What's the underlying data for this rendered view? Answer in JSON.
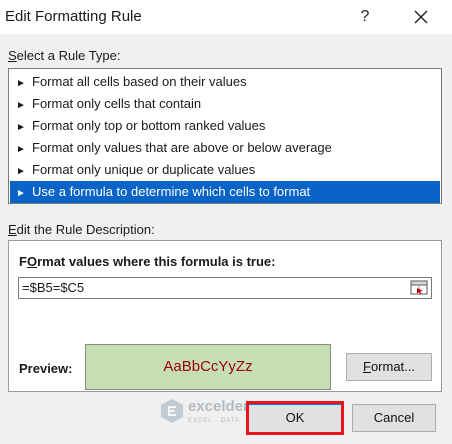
{
  "window": {
    "title": "Edit Formatting Rule",
    "help_glyph": "?",
    "close_glyph": "✕"
  },
  "rule_type": {
    "label": "Select a Rule Type:",
    "label_accel": "S",
    "label_rest": "elect a Rule Type:",
    "items": [
      {
        "label": "Format all cells based on their values",
        "selected": false
      },
      {
        "label": "Format only cells that contain",
        "selected": false
      },
      {
        "label": "Format only top or bottom ranked values",
        "selected": false
      },
      {
        "label": "Format only values that are above or below average",
        "selected": false
      },
      {
        "label": "Format only unique or duplicate values",
        "selected": false
      },
      {
        "label": "Use a formula to determine which cells to format",
        "selected": true
      }
    ],
    "arrow_glyph": "►"
  },
  "rule_description": {
    "label_accel": "E",
    "label_rest": "dit the Rule Description:",
    "heading_accel": "O",
    "heading_pre": "F",
    "heading_rest": "rmat values where this formula is true:",
    "formula_value": "=$B5=$C5",
    "preview_label": "Preview:",
    "preview_sample": "AaBbCcYyZz",
    "format_button_accel": "F",
    "format_button_rest": "ormat..."
  },
  "footer": {
    "ok_label": "OK",
    "cancel_label": "Cancel"
  },
  "watermark": {
    "name": "exceldemy",
    "tagline": "EXCEL · DATA · BI"
  },
  "colors": {
    "selection": "#0a64c8",
    "preview_fill": "#c6e0b4",
    "preview_text": "#9c0006",
    "highlight": "#e8151e"
  }
}
